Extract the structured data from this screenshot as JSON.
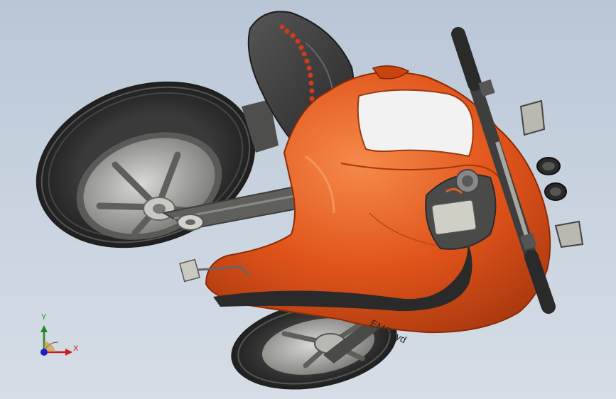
{
  "viewport": {
    "background_top": "#b9c6d6",
    "background_bottom": "#d6dde6"
  },
  "model": {
    "body_color": "#e0531a",
    "body_highlight": "#f07a3c",
    "seat_color": "#3a3a3a",
    "tire_color": "#2c2c2c",
    "rim_color": "#9a9a96",
    "decal_text": "EMO-tyd"
  },
  "triad": {
    "x_label": "X",
    "y_label": "Y",
    "x_color": "#c81e1e",
    "y_color": "#1e8a1e",
    "z_color": "#1e1ec8"
  }
}
